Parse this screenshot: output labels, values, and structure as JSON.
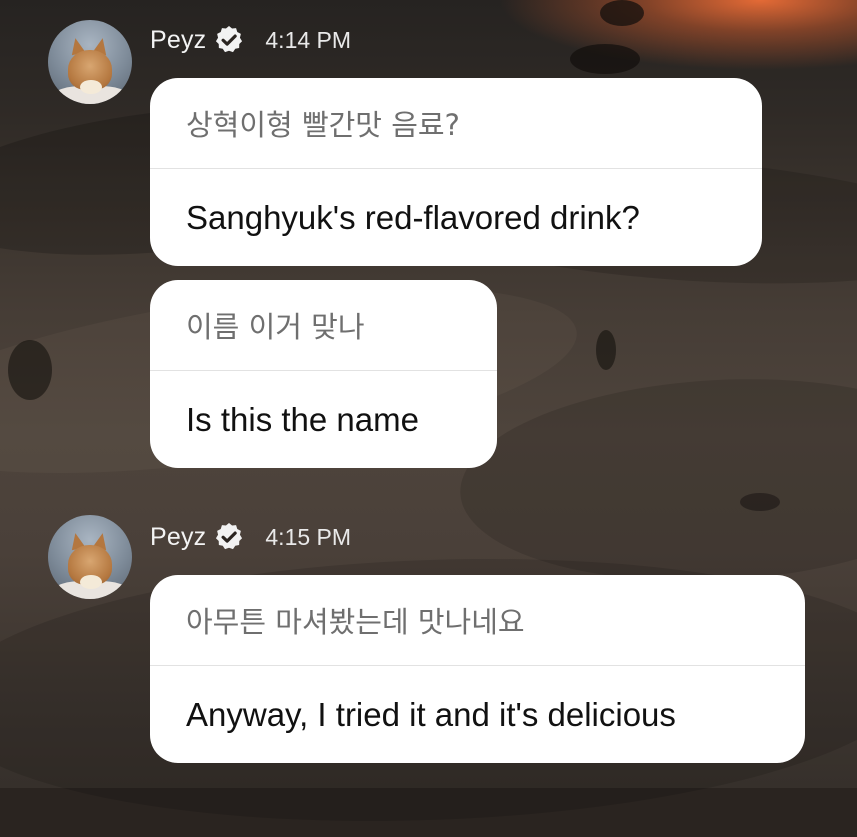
{
  "thread": [
    {
      "author": "Peyz",
      "time": "4:14 PM",
      "messages": [
        {
          "original": "상혁이형 빨간맛 음료?",
          "translation": "Sanghyuk's red-flavored drink?"
        },
        {
          "original": "이름 이거 맞나",
          "translation": "Is this the name"
        }
      ]
    },
    {
      "author": "Peyz",
      "time": "4:15 PM",
      "messages": [
        {
          "original": "아무튼 마셔봤는데 맛나네요",
          "translation": "Anyway, I tried it and it's delicious"
        }
      ]
    }
  ],
  "icons": {
    "verified": "verified-check-icon"
  },
  "colors": {
    "bubble_bg": "#ffffff",
    "original_text": "#6f6f6f",
    "translation_text": "#111111",
    "header_text": "#f3f3f3"
  }
}
